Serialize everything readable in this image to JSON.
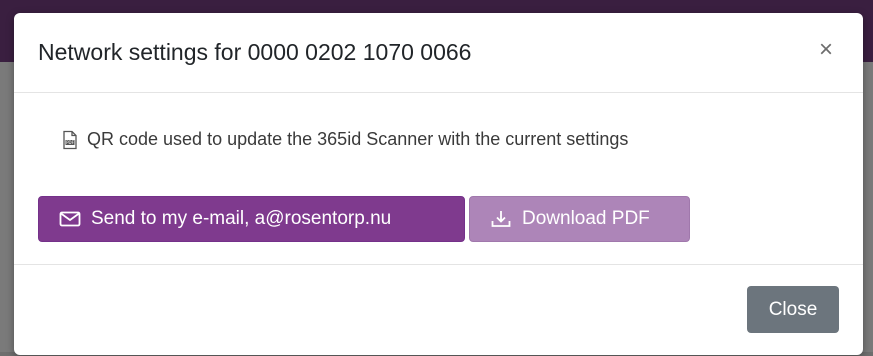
{
  "modal": {
    "title": "Network settings for 0000 0202 1070 0066",
    "close_symbol": "×",
    "qr_text": "QR code used to update the 365id Scanner with the current settings",
    "qr_icon": "pdf-file-icon",
    "email_button": {
      "label": "Send to my e-mail, a@rosentorp.nu",
      "icon": "envelope-icon"
    },
    "pdf_button": {
      "label": "Download PDF",
      "icon": "download-icon"
    },
    "close_button": "Close"
  },
  "colors": {
    "primary": "#7f3a8e",
    "primary_light": "#ad85b8",
    "secondary": "#6c757d"
  }
}
